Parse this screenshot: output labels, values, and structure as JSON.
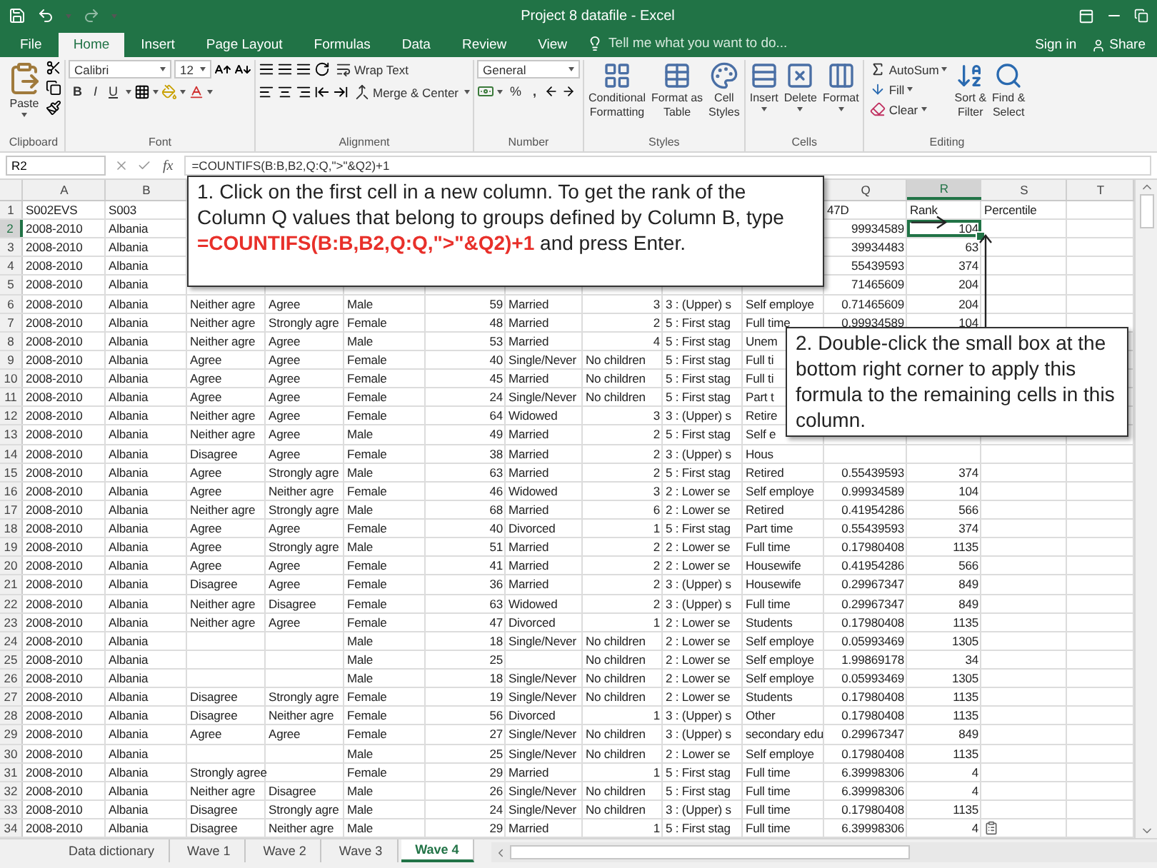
{
  "window": {
    "title": "Project 8 datafile - Excel"
  },
  "ribbon_tabs": [
    {
      "label": "File",
      "selected": false
    },
    {
      "label": "Home",
      "selected": true
    },
    {
      "label": "Insert",
      "selected": false
    },
    {
      "label": "Page Layout",
      "selected": false
    },
    {
      "label": "Formulas",
      "selected": false
    },
    {
      "label": "Data",
      "selected": false
    },
    {
      "label": "Review",
      "selected": false
    },
    {
      "label": "View",
      "selected": false
    }
  ],
  "tell_me": {
    "placeholder": "Tell me what you want to do..."
  },
  "account": {
    "sign_in": "Sign in",
    "share": "Share"
  },
  "ribbon": {
    "clipboard": {
      "paste": "Paste",
      "label": "Clipboard"
    },
    "font": {
      "name": "Calibri",
      "size": "12",
      "bold": "B",
      "italic": "I",
      "underline": "U",
      "label": "Font"
    },
    "alignment": {
      "wrap_text": "Wrap Text",
      "merge": "Merge & Center",
      "label": "Alignment"
    },
    "number": {
      "format": "General",
      "percent": "%",
      "comma": ",",
      "label": "Number"
    },
    "styles": {
      "buttons": [
        [
          "Conditional",
          "Formatting"
        ],
        [
          "Format as",
          "Table"
        ],
        [
          "Cell",
          "Styles"
        ]
      ],
      "label": "Styles"
    },
    "cells": {
      "buttons": [
        "Insert",
        "Delete",
        "Format"
      ],
      "label": "Cells"
    },
    "editing": {
      "autosum": "AutoSum",
      "fill": "Fill",
      "clear": "Clear",
      "buttons": [
        [
          "Sort &",
          "Filter"
        ],
        [
          "Find &",
          "Select"
        ]
      ],
      "label": "Editing"
    }
  },
  "formula_bar": {
    "name_box": "R2",
    "insert_function": "fx",
    "formula": "=COUNTIFS(B:B,B2,Q:Q,\">\"&Q2)+1"
  },
  "column_headers": [
    {
      "label": "A",
      "selected": false
    },
    {
      "label": "B",
      "selected": false
    },
    {
      "label": "Q",
      "selected": false
    },
    {
      "label": "R",
      "selected": true
    },
    {
      "label": "S",
      "selected": false
    },
    {
      "label": "T",
      "selected": false
    }
  ],
  "rows": [
    {
      "n": "1",
      "selected": false,
      "cells": {
        "a": "S002EVS",
        "b": "S003",
        "q": "47D",
        "r": "Rank",
        "s": "Percentile"
      }
    },
    {
      "n": "2",
      "selected": true,
      "cells": {
        "a": "2008-2010",
        "b": "Albania",
        "q": "99934589",
        "r": "104"
      }
    },
    {
      "n": "3",
      "selected": false,
      "cells": {
        "a": "2008-2010",
        "b": "Albania",
        "q": "39934483",
        "r": "63"
      }
    },
    {
      "n": "4",
      "selected": false,
      "cells": {
        "a": "2008-2010",
        "b": "Albania",
        "q": "55439593",
        "r": "374"
      }
    },
    {
      "n": "5",
      "selected": false,
      "cells": {
        "a": "2008-2010",
        "b": "Albania",
        "q": "71465609",
        "r": "204"
      }
    },
    {
      "n": "6",
      "selected": false,
      "cells": {
        "a": "2008-2010",
        "b": "Albania",
        "c": "Neither agre",
        "d": "Agree",
        "e": "Male",
        "f": "59",
        "g": "Married",
        "h": "3",
        "i": "3 : (Upper) s",
        "j": "Self employe",
        "q": "0.71465609",
        "r": "204"
      }
    },
    {
      "n": "7",
      "selected": false,
      "cells": {
        "a": "2008-2010",
        "b": "Albania",
        "c": "Neither agre",
        "d": "Strongly agre",
        "e": "Female",
        "f": "48",
        "g": "Married",
        "h": "2",
        "i": "5 : First stag",
        "j": "Full time",
        "q": "0.99934589",
        "r": "104"
      }
    },
    {
      "n": "8",
      "selected": false,
      "cells": {
        "a": "2008-2010",
        "b": "Albania",
        "c": "Neither agre",
        "d": "Agree",
        "e": "Male",
        "f": "53",
        "g": "Married",
        "h": "4",
        "i": "5 : First stag",
        "j": "Unem"
      }
    },
    {
      "n": "9",
      "selected": false,
      "cells": {
        "a": "2008-2010",
        "b": "Albania",
        "c": "Agree",
        "d": "Agree",
        "e": "Female",
        "f": "40",
        "g": "Single/Never",
        "h": "No children",
        "i": "5 : First stag",
        "j": "Full ti"
      }
    },
    {
      "n": "10",
      "selected": false,
      "cells": {
        "a": "2008-2010",
        "b": "Albania",
        "c": "Agree",
        "d": "Agree",
        "e": "Female",
        "f": "45",
        "g": "Married",
        "h": "No children",
        "i": "5 : First stag",
        "j": "Full ti"
      }
    },
    {
      "n": "11",
      "selected": false,
      "cells": {
        "a": "2008-2010",
        "b": "Albania",
        "c": "Agree",
        "d": "Agree",
        "e": "Female",
        "f": "24",
        "g": "Single/Never",
        "h": "No children",
        "i": "5 : First stag",
        "j": "Part t"
      }
    },
    {
      "n": "12",
      "selected": false,
      "cells": {
        "a": "2008-2010",
        "b": "Albania",
        "c": "Neither agre",
        "d": "Agree",
        "e": "Female",
        "f": "64",
        "g": "Widowed",
        "h": "3",
        "i": "3 : (Upper) s",
        "j": "Retire"
      }
    },
    {
      "n": "13",
      "selected": false,
      "cells": {
        "a": "2008-2010",
        "b": "Albania",
        "c": "Neither agre",
        "d": "Agree",
        "e": "Male",
        "f": "49",
        "g": "Married",
        "h": "2",
        "i": "5 : First stag",
        "j": "Self e"
      }
    },
    {
      "n": "14",
      "selected": false,
      "cells": {
        "a": "2008-2010",
        "b": "Albania",
        "c": "Disagree",
        "d": "Agree",
        "e": "Female",
        "f": "38",
        "g": "Married",
        "h": "2",
        "i": "3 : (Upper) s",
        "j": "Hous"
      }
    },
    {
      "n": "15",
      "selected": false,
      "cells": {
        "a": "2008-2010",
        "b": "Albania",
        "c": "Agree",
        "d": "Strongly agre",
        "e": "Male",
        "f": "63",
        "g": "Married",
        "h": "2",
        "i": "5 : First stag",
        "j": "Retired",
        "q": "0.55439593",
        "r": "374"
      }
    },
    {
      "n": "16",
      "selected": false,
      "cells": {
        "a": "2008-2010",
        "b": "Albania",
        "c": "Agree",
        "d": "Neither agre",
        "e": "Female",
        "f": "46",
        "g": "Widowed",
        "h": "3",
        "i": "2 : Lower se",
        "j": "Self employe",
        "q": "0.99934589",
        "r": "104"
      }
    },
    {
      "n": "17",
      "selected": false,
      "cells": {
        "a": "2008-2010",
        "b": "Albania",
        "c": "Neither agre",
        "d": "Strongly agre",
        "e": "Male",
        "f": "68",
        "g": "Married",
        "h": "6",
        "i": "2 : Lower se",
        "j": "Retired",
        "q": "0.41954286",
        "r": "566"
      }
    },
    {
      "n": "18",
      "selected": false,
      "cells": {
        "a": "2008-2010",
        "b": "Albania",
        "c": "Agree",
        "d": "Agree",
        "e": "Female",
        "f": "40",
        "g": "Divorced",
        "h": "1",
        "i": "5 : First stag",
        "j": "Part time",
        "q": "0.55439593",
        "r": "374"
      }
    },
    {
      "n": "19",
      "selected": false,
      "cells": {
        "a": "2008-2010",
        "b": "Albania",
        "c": "Agree",
        "d": "Strongly agre",
        "e": "Male",
        "f": "51",
        "g": "Married",
        "h": "2",
        "i": "2 : Lower se",
        "j": "Full time",
        "q": "0.17980408",
        "r": "1135"
      }
    },
    {
      "n": "20",
      "selected": false,
      "cells": {
        "a": "2008-2010",
        "b": "Albania",
        "c": "Agree",
        "d": "Agree",
        "e": "Female",
        "f": "41",
        "g": "Married",
        "h": "2",
        "i": "2 : Lower se",
        "j": "Housewife",
        "q": "0.41954286",
        "r": "566"
      }
    },
    {
      "n": "21",
      "selected": false,
      "cells": {
        "a": "2008-2010",
        "b": "Albania",
        "c": "Disagree",
        "d": "Agree",
        "e": "Female",
        "f": "36",
        "g": "Married",
        "h": "2",
        "i": "3 : (Upper) s",
        "j": "Housewife",
        "q": "0.29967347",
        "r": "849"
      }
    },
    {
      "n": "22",
      "selected": false,
      "cells": {
        "a": "2008-2010",
        "b": "Albania",
        "c": "Neither agre",
        "d": "Disagree",
        "e": "Female",
        "f": "63",
        "g": "Widowed",
        "h": "2",
        "i": "3 : (Upper) s",
        "j": "Full time",
        "q": "0.29967347",
        "r": "849"
      }
    },
    {
      "n": "23",
      "selected": false,
      "cells": {
        "a": "2008-2010",
        "b": "Albania",
        "c": "Neither agre",
        "d": "Agree",
        "e": "Female",
        "f": "47",
        "g": "Divorced",
        "h": "1",
        "i": "2 : Lower se",
        "j": "Students",
        "q": "0.17980408",
        "r": "1135"
      }
    },
    {
      "n": "24",
      "selected": false,
      "cells": {
        "a": "2008-2010",
        "b": "Albania",
        "e": "Male",
        "f": "18",
        "g": "Single/Never",
        "h": "No children",
        "i": "2 : Lower se",
        "j": "Self employe",
        "q": "0.05993469",
        "r": "1305"
      }
    },
    {
      "n": "25",
      "selected": false,
      "cells": {
        "a": "2008-2010",
        "b": "Albania",
        "e": "Male",
        "f": "25",
        "h": "No children",
        "i": "2 : Lower se",
        "j": "Self employe",
        "q": "1.99869178",
        "r": "34"
      }
    },
    {
      "n": "26",
      "selected": false,
      "cells": {
        "a": "2008-2010",
        "b": "Albania",
        "e": "Male",
        "f": "18",
        "g": "Single/Never",
        "h": "No children",
        "i": "2 : Lower se",
        "j": "Self employe",
        "q": "0.05993469",
        "r": "1305"
      }
    },
    {
      "n": "27",
      "selected": false,
      "cells": {
        "a": "2008-2010",
        "b": "Albania",
        "c": "Disagree",
        "d": "Strongly agre",
        "e": "Female",
        "f": "19",
        "g": "Single/Never",
        "h": "No children",
        "i": "2 : Lower se",
        "j": "Students",
        "q": "0.17980408",
        "r": "1135"
      }
    },
    {
      "n": "28",
      "selected": false,
      "cells": {
        "a": "2008-2010",
        "b": "Albania",
        "c": "Disagree",
        "d": "Neither agre",
        "e": "Female",
        "f": "56",
        "g": "Divorced",
        "h": "1",
        "i": "3 : (Upper) s",
        "j": "Other",
        "q": "0.17980408",
        "r": "1135"
      }
    },
    {
      "n": "29",
      "selected": false,
      "cells": {
        "a": "2008-2010",
        "b": "Albania",
        "c": "Agree",
        "d": "Agree",
        "e": "Female",
        "f": "27",
        "g": "Single/Never",
        "h": "No children",
        "i": "3 : (Upper) s",
        "j": "secondary edu",
        "q": "0.29967347",
        "r": "849"
      }
    },
    {
      "n": "30",
      "selected": false,
      "cells": {
        "a": "2008-2010",
        "b": "Albania",
        "e": "Male",
        "f": "25",
        "g": "Single/Never",
        "h": "No children",
        "i": "2 : Lower se",
        "j": "Self employe",
        "q": "0.17980408",
        "r": "1135"
      }
    },
    {
      "n": "31",
      "selected": false,
      "cells": {
        "a": "2008-2010",
        "b": "Albania",
        "c": "Strongly agree",
        "e": "Female",
        "f": "29",
        "g": "Married",
        "h": "1",
        "i": "5 : First stag",
        "j": "Full time",
        "q": "6.39998306",
        "r": "4"
      }
    },
    {
      "n": "32",
      "selected": false,
      "cells": {
        "a": "2008-2010",
        "b": "Albania",
        "c": "Neither agre",
        "d": "Disagree",
        "e": "Male",
        "f": "26",
        "g": "Single/Never",
        "h": "No children",
        "i": "5 : First stag",
        "j": "Full time",
        "q": "6.39998306",
        "r": "4"
      }
    },
    {
      "n": "33",
      "selected": false,
      "cells": {
        "a": "2008-2010",
        "b": "Albania",
        "c": "Disagree",
        "d": "Strongly agre",
        "e": "Male",
        "f": "24",
        "g": "Single/Never",
        "h": "No children",
        "i": "3 : (Upper) s",
        "j": "Full time",
        "q": "0.17980408",
        "r": "1135"
      }
    },
    {
      "n": "34",
      "selected": false,
      "cells": {
        "a": "2008-2010",
        "b": "Albania",
        "c": "Disagree",
        "d": "Neither agre",
        "e": "Male",
        "f": "29",
        "g": "Married",
        "h": "1",
        "i": "5 : First stag",
        "j": "Full time",
        "q": "6.39998306",
        "r": "4"
      }
    }
  ],
  "callouts": [
    {
      "text": "1. Click on the first cell in a new column. To get the rank of the Column Q values that belong to groups defined by Column B, type **=COUNTIFS(B:B,B2,Q:Q,\">\"&Q2)+1** and press Enter."
    },
    {
      "text": "2. Double-click the small box at the bottom right corner to apply this formula to the remaining cells in this column."
    }
  ],
  "sheet_tabs": [
    {
      "label": "Data dictionary",
      "selected": false
    },
    {
      "label": "Wave 1",
      "selected": false
    },
    {
      "label": "Wave 2",
      "selected": false
    },
    {
      "label": "Wave 3",
      "selected": false
    },
    {
      "label": "Wave 4",
      "selected": true
    }
  ]
}
